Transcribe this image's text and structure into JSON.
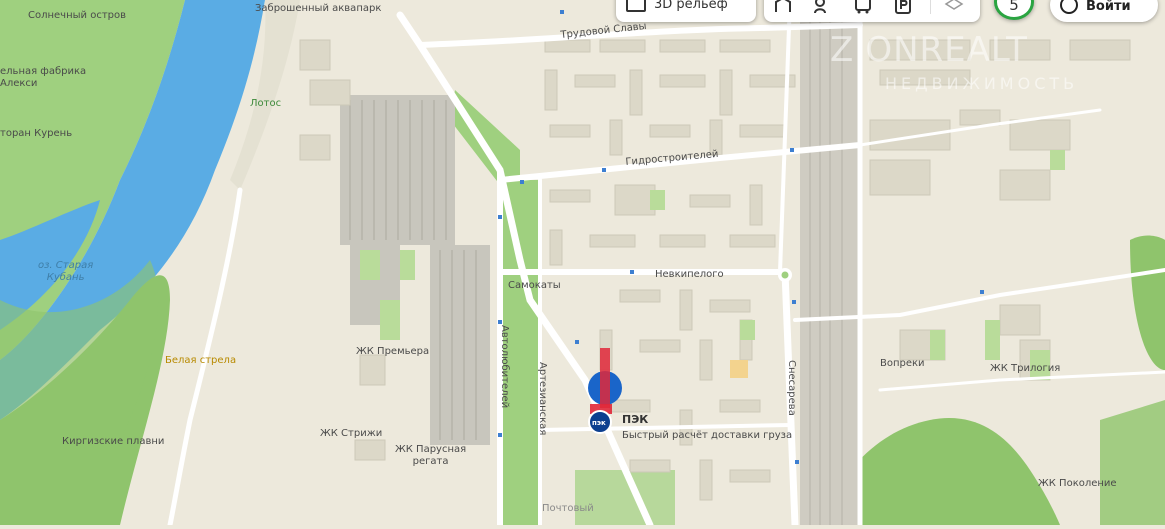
{
  "map": {
    "labels": {
      "island": "Солнечный остров",
      "aquapark": "Заброшенный аквапарк",
      "factory": "ельная фабрика\nАлекси",
      "lotos": "Лотос",
      "restaurant": "торан Курень",
      "old_kuban": "оз. Старая\nКубань",
      "belaya_strela": "Белая стрела",
      "kirgiz": "Киргизские плавни",
      "premiera": "ЖК Премьера",
      "strizhi": "ЖК Стрижи",
      "parusnaya": "ЖК Парусная\nрегата",
      "pochtovy": "Почтовый",
      "samokaty": "Самокаты",
      "voprek": "Вопреки",
      "trilogiya": "ЖК Трилогия",
      "pokolenie": "ЖК Поколение"
    },
    "streets": {
      "trudovoy": "Трудовой Славы",
      "gidro": "Гидростроителей",
      "nevkipelogo": "Невкипелого",
      "avtolubiteley": "Автолюбителей",
      "artezianskaya": "Артезианская",
      "snesareva": "Снесарева"
    },
    "poi": {
      "name": "ПЭК",
      "description": "Быстрый расчёт доставки груза",
      "logo_text": "пэк"
    },
    "watermark": {
      "brand": "ZIONREALT",
      "sub": "НЕДВИЖИМОСТЬ"
    },
    "colors": {
      "water": "#5aace4",
      "park": "#9fd07f",
      "forest": "#8fc46c",
      "base": "#ede9dc",
      "building": "#dcd8c8",
      "road": "#ffffff",
      "marker": "#1a65c9",
      "arrow": "#e0283a",
      "accent": "#2aa441"
    }
  },
  "controls": {
    "relief_label": "3D рельеф",
    "zoom_value": "5",
    "login_label": "Войти",
    "icons": [
      "relief-icon",
      "route-icon",
      "traffic-icon",
      "transport-icon",
      "parking-icon",
      "layers-icon",
      "login-icon"
    ]
  }
}
